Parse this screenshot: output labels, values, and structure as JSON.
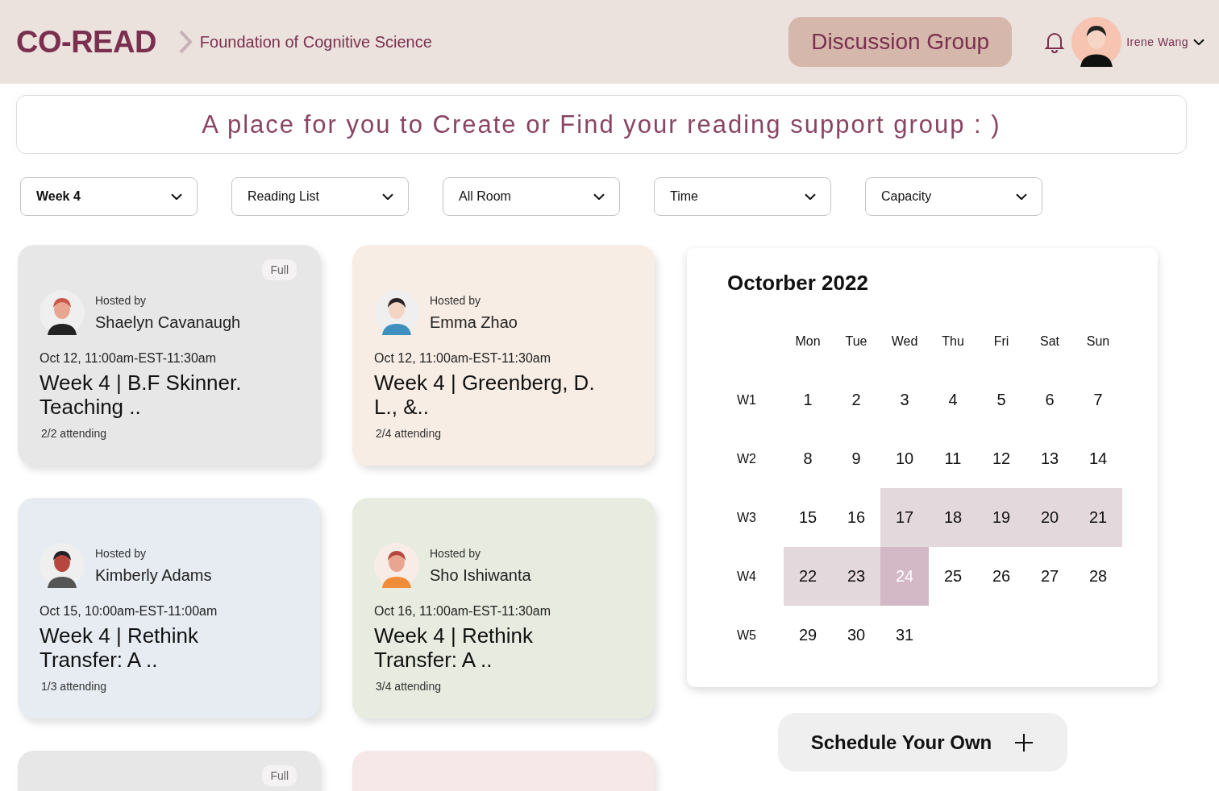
{
  "header": {
    "logo": "CO-READ",
    "breadcrumb": "Foundation of Cognitive Science",
    "nav_button": {
      "label": "Discussion Group",
      "selected": true
    },
    "user": {
      "name": "Irene Wang"
    }
  },
  "banner": "A place for you to Create or Find your reading support group : )",
  "filters": [
    {
      "label": "Week 4",
      "selected": true
    },
    {
      "label": "Reading List",
      "selected": false
    },
    {
      "label": "All Room",
      "selected": false
    },
    {
      "label": "Time",
      "selected": false
    },
    {
      "label": "Capacity",
      "selected": false
    }
  ],
  "cards": [
    {
      "color": "#e8e7e7",
      "badge": "Full",
      "hosted_label": "Hosted by",
      "host": "Shaelyn Cavanaugh",
      "time": "Oct 12, 11:00am-EST-11:30am",
      "title": "Week 4 | B.F Skinner. Teaching ..",
      "attending": "2/2 attending"
    },
    {
      "color": "#f7ede5",
      "hosted_label": "Hosted by",
      "host": "Emma Zhao",
      "time": "Oct 12, 11:00am-EST-11:30am",
      "title": "Week 4 | Greenberg, D. L., &..",
      "attending": "2/4 attending"
    },
    {
      "color": "#e6ecf2",
      "hosted_label": "Hosted by",
      "host": "Kimberly Adams",
      "time": "Oct 15, 10:00am-EST-11:00am",
      "title": "Week 4 | Rethink Transfer: A ..",
      "attending": "1/3 attending"
    },
    {
      "color": "#e8ebdf",
      "hosted_label": "Hosted by",
      "host": "Sho Ishiwanta",
      "time": "Oct 16, 11:00am-EST-11:30am",
      "title": "Week 4 | Rethink Transfer: A ..",
      "attending": "3/4 attending"
    },
    {
      "color": "#e8e7e7",
      "badge": "Full"
    },
    {
      "color": "#f6e7e8"
    }
  ],
  "calendar": {
    "title": "Octorber 2022",
    "weekdays": [
      "Mon",
      "Tue",
      "Wed",
      "Thu",
      "Fri",
      "Sat",
      "Sun"
    ],
    "weeks": [
      {
        "label": "W1",
        "days": [
          {
            "day": "1",
            "in_range": false,
            "selected": false
          },
          {
            "day": "2",
            "in_range": false,
            "selected": false
          },
          {
            "day": "3",
            "in_range": false,
            "selected": false
          },
          {
            "day": "4",
            "in_range": false,
            "selected": false
          },
          {
            "day": "5",
            "in_range": false,
            "selected": false
          },
          {
            "day": "6",
            "in_range": false,
            "selected": false
          },
          {
            "day": "7",
            "in_range": false,
            "selected": false
          }
        ]
      },
      {
        "label": "W2",
        "days": [
          {
            "day": "8",
            "in_range": false,
            "selected": false
          },
          {
            "day": "9",
            "in_range": false,
            "selected": false
          },
          {
            "day": "10",
            "in_range": false,
            "selected": false
          },
          {
            "day": "11",
            "in_range": false,
            "selected": false
          },
          {
            "day": "12",
            "in_range": false,
            "selected": false
          },
          {
            "day": "13",
            "in_range": false,
            "selected": false
          },
          {
            "day": "14",
            "in_range": false,
            "selected": false
          }
        ]
      },
      {
        "label": "W3",
        "days": [
          {
            "day": "15",
            "in_range": false,
            "selected": false
          },
          {
            "day": "16",
            "in_range": false,
            "selected": false
          },
          {
            "day": "17",
            "in_range": true,
            "selected": false
          },
          {
            "day": "18",
            "in_range": true,
            "selected": false
          },
          {
            "day": "19",
            "in_range": true,
            "selected": false
          },
          {
            "day": "20",
            "in_range": true,
            "selected": false
          },
          {
            "day": "21",
            "in_range": true,
            "selected": false
          }
        ]
      },
      {
        "label": "W4",
        "days": [
          {
            "day": "22",
            "in_range": true,
            "selected": false
          },
          {
            "day": "23",
            "in_range": true,
            "selected": false
          },
          {
            "day": "24",
            "in_range": true,
            "selected": true
          },
          {
            "day": "25",
            "in_range": false,
            "selected": false
          },
          {
            "day": "26",
            "in_range": false,
            "selected": false
          },
          {
            "day": "27",
            "in_range": false,
            "selected": false
          },
          {
            "day": "28",
            "in_range": false,
            "selected": false
          }
        ]
      },
      {
        "label": "W5",
        "days": [
          {
            "day": "29",
            "in_range": false,
            "selected": false
          },
          {
            "day": "30",
            "in_range": false,
            "selected": false
          },
          {
            "day": "31",
            "in_range": false,
            "selected": false
          }
        ]
      }
    ]
  },
  "schedule_button": "Schedule Your Own"
}
